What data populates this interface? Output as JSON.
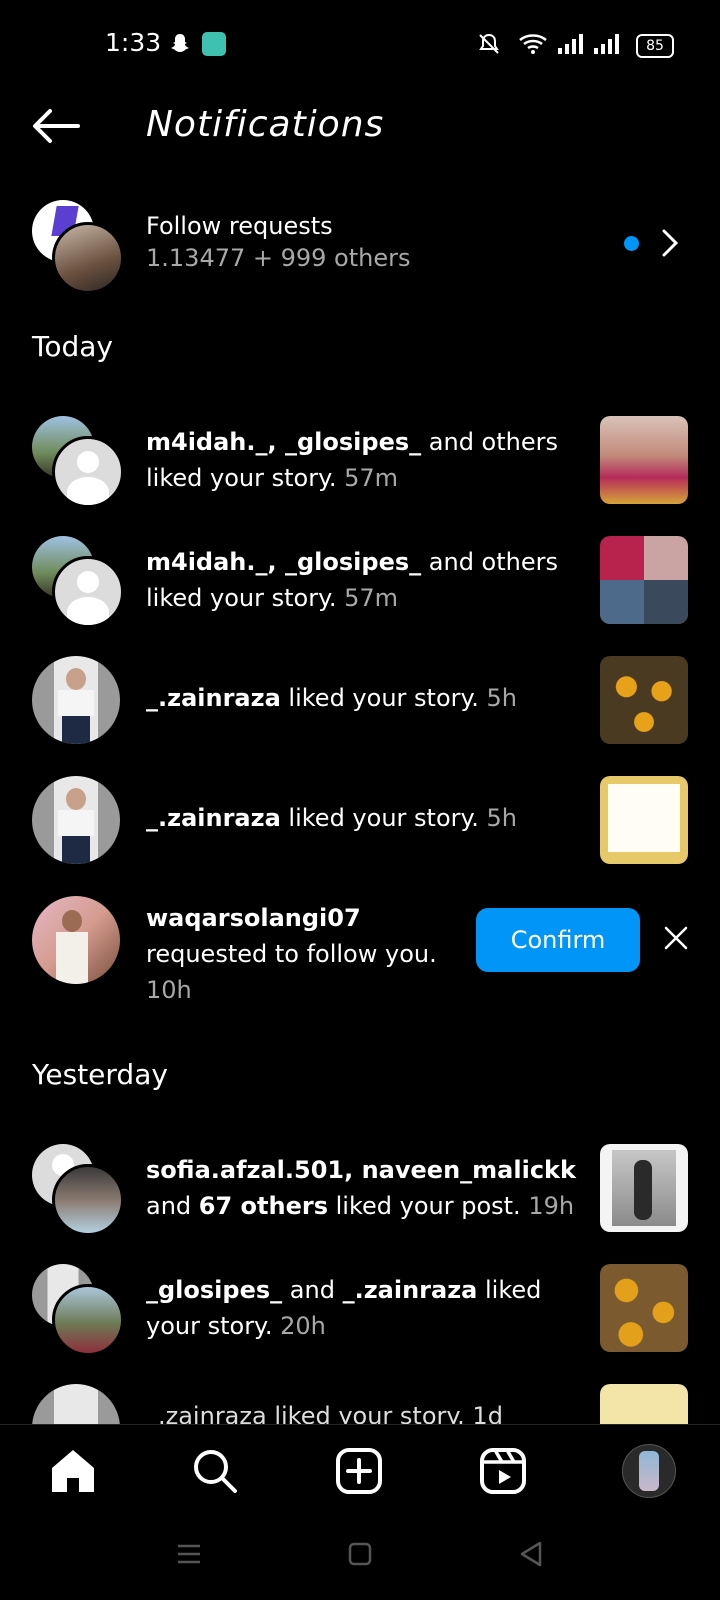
{
  "status_bar": {
    "time": "1:33",
    "battery": "85"
  },
  "header": {
    "title": "Notifications"
  },
  "follow_requests": {
    "title": "Follow requests",
    "subtitle": "1.13477 + 999 others"
  },
  "sections": {
    "today": "Today",
    "yesterday": "Yesterday"
  },
  "notifications": [
    {
      "users": "m4idah._, _glosipes_",
      "action_1": " and others",
      "action_2": "liked your story. ",
      "time": "57m"
    },
    {
      "users": "m4idah._, _glosipes_",
      "action_1": " and others",
      "action_2": "liked your story. ",
      "time": "57m"
    },
    {
      "users": "_.zainraza",
      "action": " liked your story. ",
      "time": "5h"
    },
    {
      "users": "_.zainraza",
      "action": " liked your story. ",
      "time": "5h"
    },
    {
      "users": "waqarsolangi07",
      "action": "requested to follow you.",
      "time": "10h",
      "confirm_label": "Confirm"
    },
    {
      "users": "sofia.afzal.501, naveen_malickk",
      "action_1": "and ",
      "count": "67 others",
      "action_2": " liked your post. ",
      "time": "19h"
    },
    {
      "user_a": "_glosipes_",
      "joiner": " and ",
      "user_b": "_.zainraza",
      "action_1": " liked",
      "action_2": "your story. ",
      "time": "20h"
    },
    {
      "partial": "_.zainraza liked your story. 1d"
    }
  ],
  "colors": {
    "accent": "#0095f6",
    "background": "#000000",
    "muted_text": "#a8a8a8"
  }
}
